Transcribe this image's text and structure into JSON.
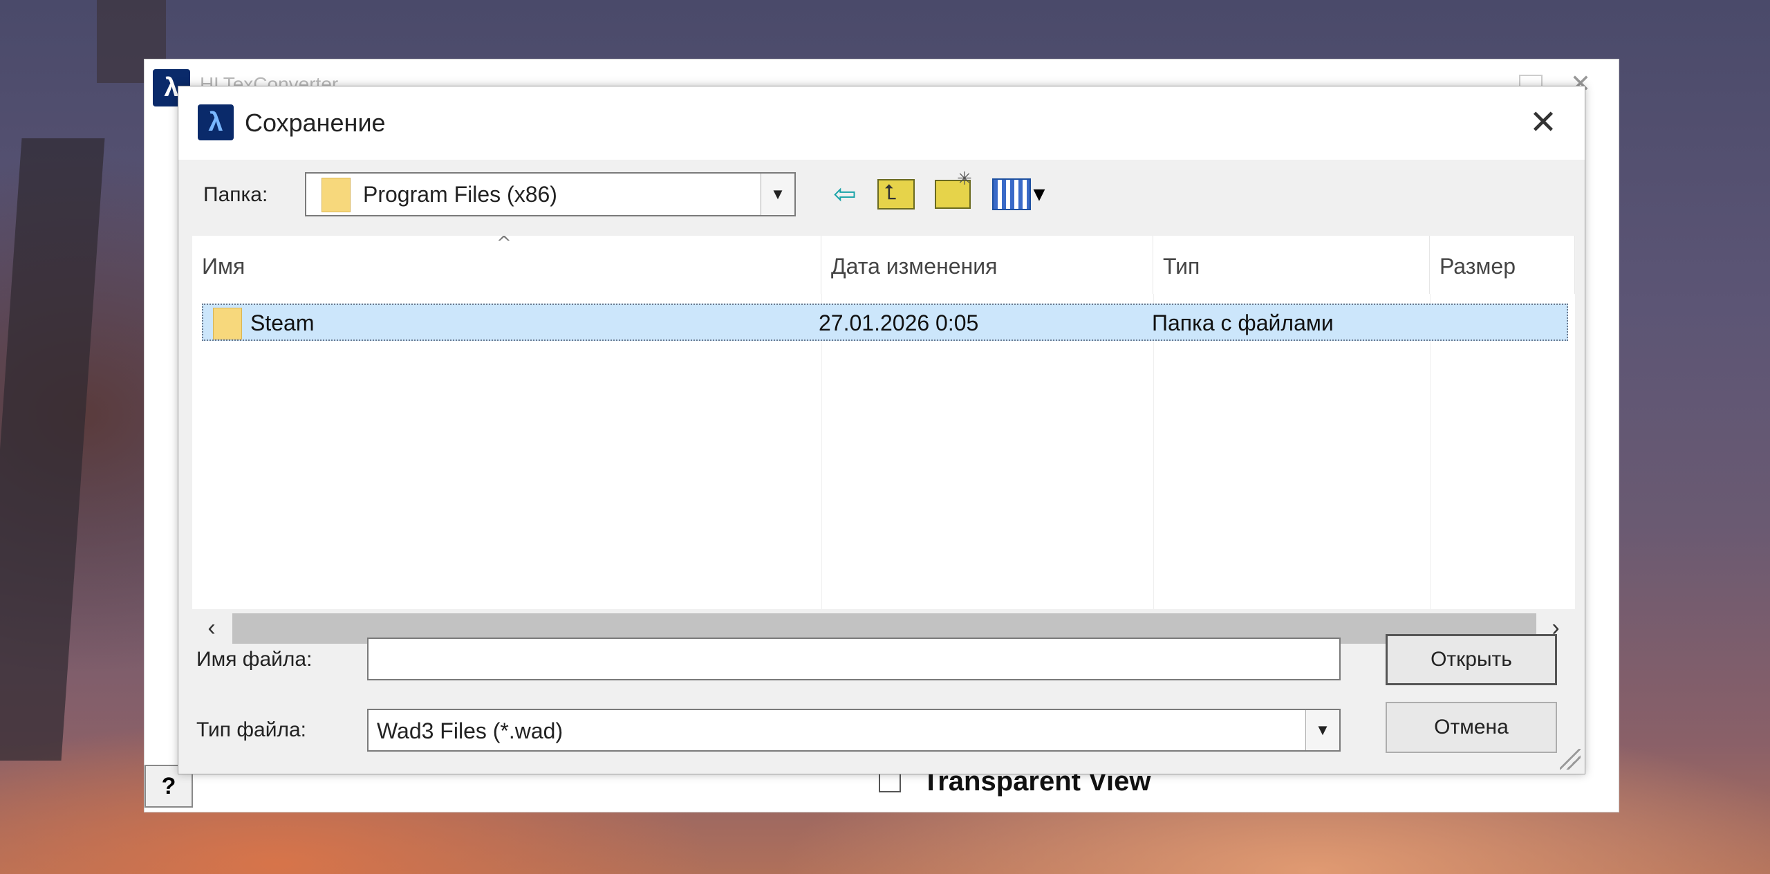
{
  "parent_window": {
    "title": "HLTexConverter",
    "help_label": "?",
    "transparent_view_label": "Transparent View",
    "transparent_view_checked": false
  },
  "dialog": {
    "title": "Сохранение",
    "folder_label": "Папка:",
    "folder_value": "Program Files (x86)",
    "toolbar": {
      "back_icon": "back-arrow-icon",
      "up_icon": "up-folder-icon",
      "new_folder_icon": "new-folder-icon",
      "view_menu_icon": "view-menu-icon"
    },
    "columns": [
      "Имя",
      "Дата изменения",
      "Тип",
      "Размер"
    ],
    "rows": [
      {
        "name": "Steam",
        "date": "27.01.2026 0:05",
        "type": "Папка с файлами",
        "size": ""
      }
    ],
    "filename_label": "Имя файла:",
    "filename_value": "",
    "filetype_label": "Тип файла:",
    "filetype_value": "Wad3 Files (*.wad)",
    "open_button": "Открыть",
    "cancel_button": "Отмена"
  },
  "colors": {
    "selection": "#cce6fb",
    "folder": "#f7d87c",
    "accent_arrow": "#19a3a8"
  }
}
